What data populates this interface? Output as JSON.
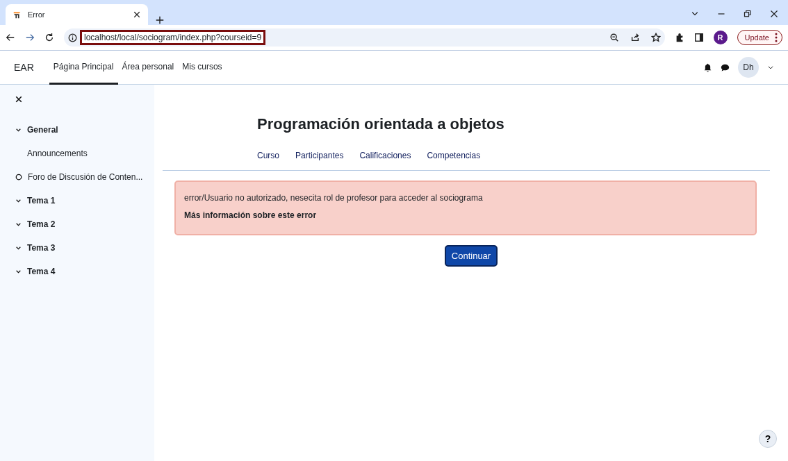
{
  "browser": {
    "tab": {
      "title": "Error"
    },
    "url": "localhost/local/sociogram/index.php?courseid=9",
    "profile_initial": "R",
    "update_label": "Update"
  },
  "navbar": {
    "brand": "EAR",
    "items": [
      {
        "label": "Página Principal",
        "selected": true
      },
      {
        "label": "Área personal",
        "selected": false
      },
      {
        "label": "Mis cursos",
        "selected": false
      }
    ],
    "avatar": "Dh"
  },
  "sidebar": {
    "items": [
      {
        "kind": "section",
        "label": "General"
      },
      {
        "kind": "activity",
        "label": "Announcements"
      },
      {
        "kind": "forum",
        "label": "Foro de Discusión de Conten..."
      },
      {
        "kind": "section",
        "label": "Tema 1"
      },
      {
        "kind": "section",
        "label": "Tema 2"
      },
      {
        "kind": "section",
        "label": "Tema 3"
      },
      {
        "kind": "section",
        "label": "Tema 4"
      }
    ]
  },
  "page": {
    "title": "Programación orientada a objetos",
    "tabs": [
      "Curso",
      "Participantes",
      "Calificaciones",
      "Competencias"
    ],
    "error": {
      "message": "error/Usuario no autorizado, nesecita rol de profesor para acceder al sociograma",
      "more_info": "Más información sobre este error"
    },
    "continue_button": "Continuar",
    "help_button": "?"
  }
}
